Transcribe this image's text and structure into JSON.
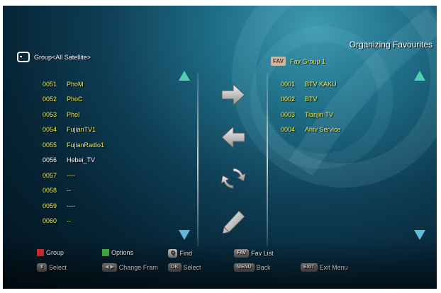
{
  "screen": {
    "title": "Organizing Favourites",
    "group_label": "Group<All Satellite>",
    "fav_badge": "FAV",
    "fav_group": "Fav Group 1"
  },
  "left_channels": [
    {
      "num": "0051",
      "name": "PhoM"
    },
    {
      "num": "0052",
      "name": "PhoC"
    },
    {
      "num": "0053",
      "name": "PhoI"
    },
    {
      "num": "0054",
      "name": "FujianTV1"
    },
    {
      "num": "0055",
      "name": "FujianRadio1"
    },
    {
      "num": "0056",
      "name": "Hebei_TV",
      "selected": true
    },
    {
      "num": "0057",
      "name": "----"
    },
    {
      "num": "0058",
      "name": "--"
    },
    {
      "num": "0059",
      "name": "----"
    },
    {
      "num": "0060",
      "name": "--"
    }
  ],
  "right_channels": [
    {
      "num": "0001",
      "name": "BTV KAKU"
    },
    {
      "num": "0002",
      "name": "BTV"
    },
    {
      "num": "0003",
      "name": "Tianjin TV"
    },
    {
      "num": "0004",
      "name": "Ahtv    Service"
    }
  ],
  "icons": {
    "left_scroll_up": "triangle-up-icon",
    "left_scroll_down": "triangle-down-icon",
    "right_scroll_up": "triangle-up-icon",
    "right_scroll_down": "triangle-down-icon",
    "add": "arrow-right-icon",
    "remove": "arrow-left-icon",
    "move": "refresh-icon",
    "rename": "pencil-icon"
  },
  "footer": {
    "group": "Group",
    "options": "Options",
    "find_key": "Q",
    "find": "Find",
    "fav_key": "FAV",
    "fav_list": "Fav List",
    "select_key": "⬍",
    "select": "Select",
    "change_key": "◀ ▶",
    "change_frame": "Change Fram",
    "ok_key": "OK",
    "ok_select": "Select",
    "menu_key": "MENU",
    "back": "Back",
    "exit_key": "EXIT",
    "exit_menu": "Exit Menu"
  },
  "colors": {
    "channel_text": "#f3eb4d",
    "selected_text": "#ffffff",
    "red_key": "#e53232",
    "green_key": "#48c04a",
    "scroll_arrow_up": "#4fd1b0",
    "scroll_arrow_down": "#60b8dc"
  }
}
